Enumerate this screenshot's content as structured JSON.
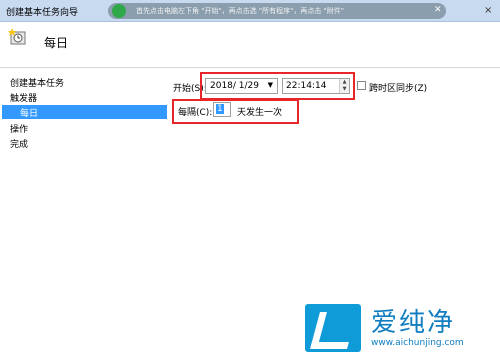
{
  "window": {
    "title": "创建基本任务向导",
    "close": "×"
  },
  "overlay": {
    "text": "首先点击电脑左下角 \"开始\"，再点击选 \"所有程序\"，再点击 \"附件\"",
    "close": "✕"
  },
  "header": {
    "title": "每日",
    "icon": "task-scheduler-icon"
  },
  "nav": {
    "items": [
      "创建基本任务",
      "触发器",
      "每日",
      "操作",
      "完成"
    ],
    "selected_index": 2
  },
  "form": {
    "start_label": "开始(S):",
    "date_value": "2018/  1/29",
    "time_value": "22:14:14",
    "sync_label": "跨时区同步(Z)",
    "sync_checked": false,
    "recur_label": "每隔(C):",
    "recur_value": "1",
    "recur_suffix": "天发生一次"
  },
  "watermark": {
    "brand": "爱纯净",
    "url": "www.aichunjing.com"
  },
  "colors": {
    "selection": "#3399ff",
    "highlight_box": "#e8262a",
    "brand": "#0f7dc0"
  }
}
